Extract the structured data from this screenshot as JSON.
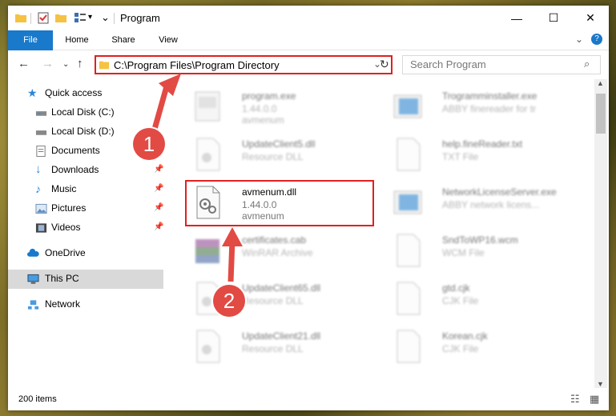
{
  "window": {
    "title": "Program"
  },
  "ribbon": {
    "tabs": [
      "File",
      "Home",
      "Share",
      "View"
    ]
  },
  "address": {
    "path": "C:\\Program Files\\Program Directory"
  },
  "search": {
    "placeholder": "Search Program"
  },
  "sidebar": {
    "items": [
      {
        "label": "Quick access",
        "icon": "star-icon"
      },
      {
        "label": "Local Disk (C:)",
        "icon": "drive-icon"
      },
      {
        "label": "Local Disk (D:)",
        "icon": "drive-icon"
      },
      {
        "label": "Documents",
        "icon": "documents-icon"
      },
      {
        "label": "Downloads",
        "icon": "downloads-icon"
      },
      {
        "label": "Music",
        "icon": "music-icon"
      },
      {
        "label": "Pictures",
        "icon": "pictures-icon"
      },
      {
        "label": "Videos",
        "icon": "videos-icon"
      },
      {
        "label": "OneDrive",
        "icon": "cloud-icon"
      },
      {
        "label": "This PC",
        "icon": "computer-icon"
      },
      {
        "label": "Network",
        "icon": "network-icon"
      }
    ]
  },
  "files": [
    {
      "name": "program.exe",
      "sub1": "1.44.0.0",
      "sub2": "avmenum"
    },
    {
      "name": "Trogramminstaller.exe",
      "sub1": "ABBY finereader for tr",
      "sub2": ""
    },
    {
      "name": "UpdateClient5.dll",
      "sub1": "Resource DLL",
      "sub2": ""
    },
    {
      "name": "help.fineReader.txt",
      "sub1": "TXT File",
      "sub2": ""
    },
    {
      "name": "avmenum.dll",
      "sub1": "1.44.0.0",
      "sub2": "avmenum"
    },
    {
      "name": "NetworkLicenseServer.exe",
      "sub1": "ABBY network licens...",
      "sub2": ""
    },
    {
      "name": "certificates.cab",
      "sub1": "WinRAR Archive",
      "sub2": ""
    },
    {
      "name": "SndToWP16.wcm",
      "sub1": "WCM File",
      "sub2": ""
    },
    {
      "name": "UpdateClient65.dll",
      "sub1": "Resource DLL",
      "sub2": ""
    },
    {
      "name": "gtd.cjk",
      "sub1": "CJK File",
      "sub2": ""
    },
    {
      "name": "UpdateClient21.dll",
      "sub1": "Resource DLL",
      "sub2": ""
    },
    {
      "name": "Korean.cjk",
      "sub1": "CJK File",
      "sub2": ""
    }
  ],
  "status": {
    "count": "200 items"
  },
  "annotations": {
    "step1": "1",
    "step2": "2"
  },
  "colors": {
    "accent": "#1979ca",
    "highlight": "#e02020",
    "badge": "#e24a44"
  }
}
